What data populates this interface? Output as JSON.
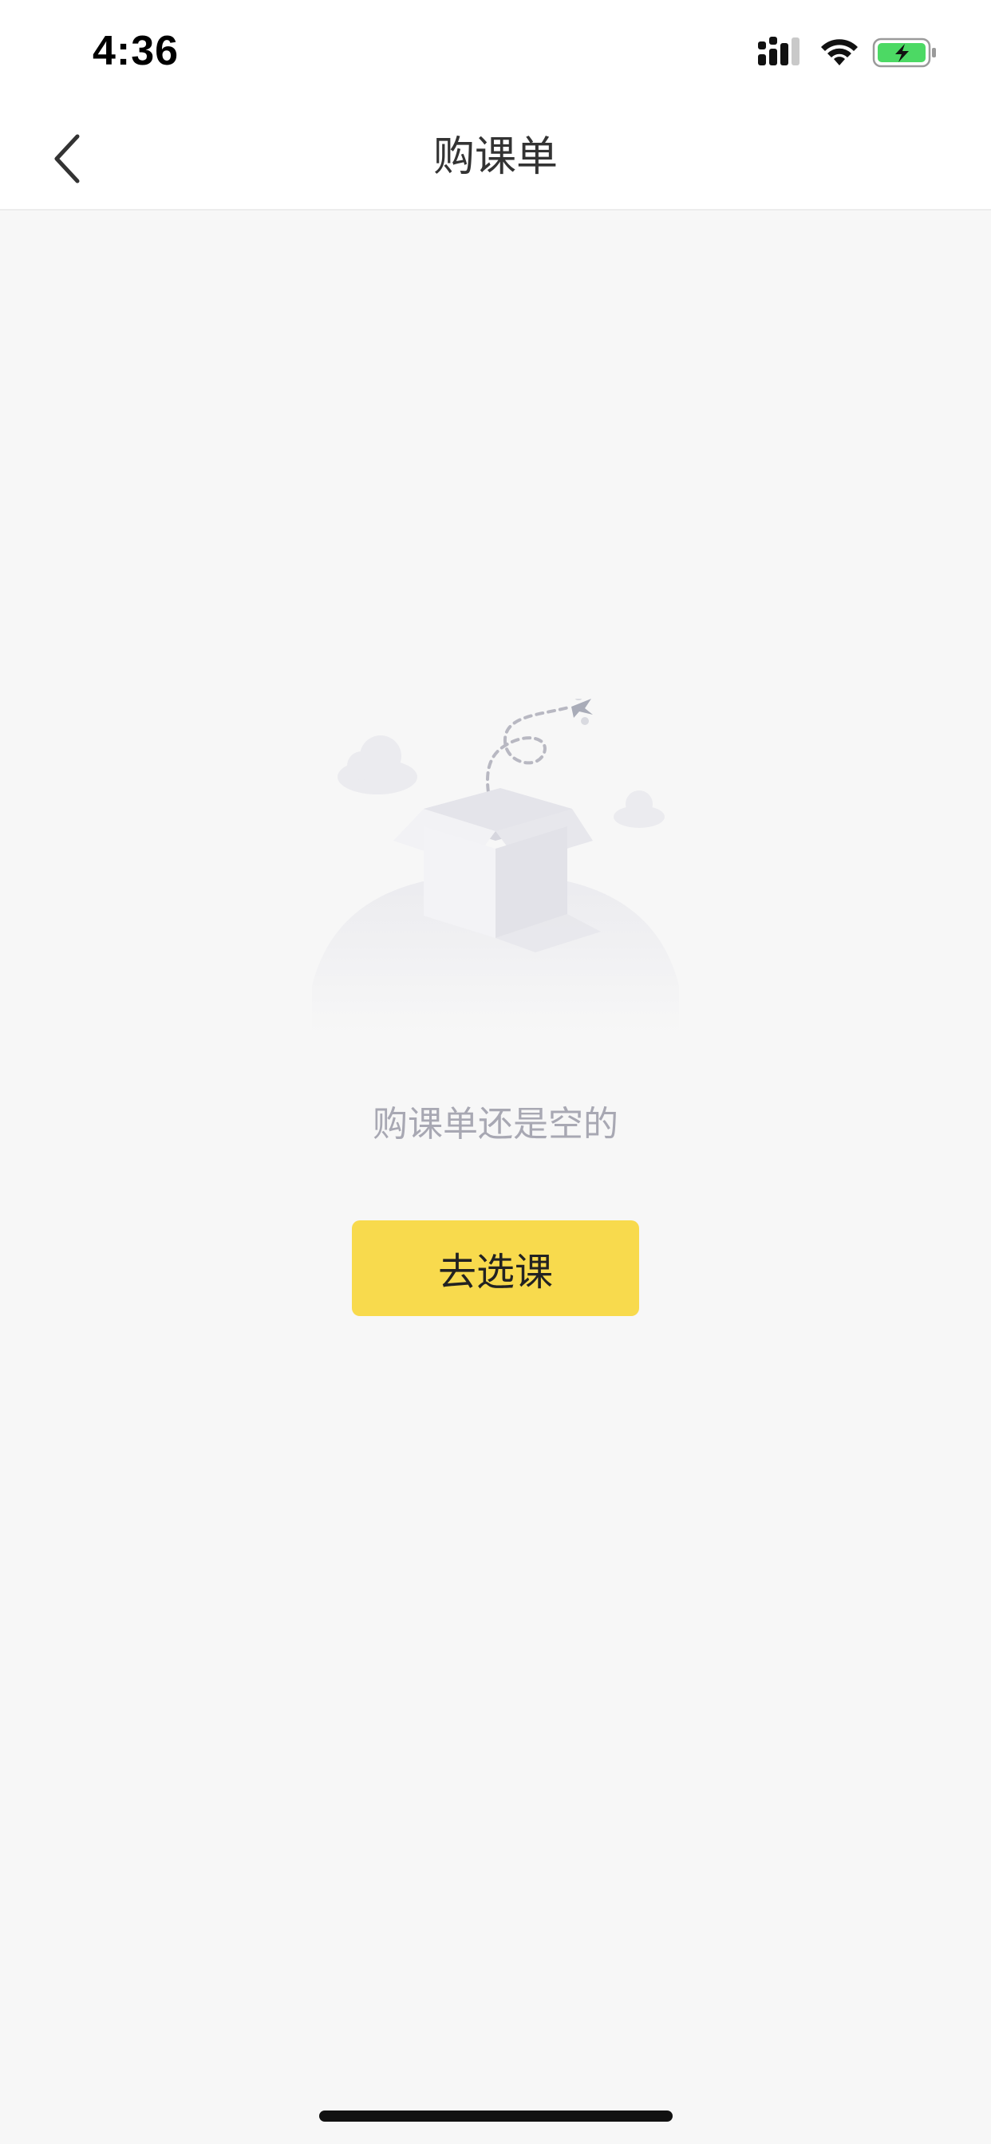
{
  "status_bar": {
    "time": "4:36",
    "icons": [
      "cellular-signal-icon",
      "wifi-icon",
      "battery-charging-icon"
    ]
  },
  "nav": {
    "title": "购课单",
    "back_icon": "chevron-left-icon"
  },
  "empty_state": {
    "illustration": "empty-box-icon",
    "message": "购课单还是空的",
    "button_label": "去选课"
  },
  "colors": {
    "accent": "#f8da4d",
    "background": "#f7f7f7",
    "text_muted": "#a8a8b3",
    "battery": "#4cd964"
  }
}
